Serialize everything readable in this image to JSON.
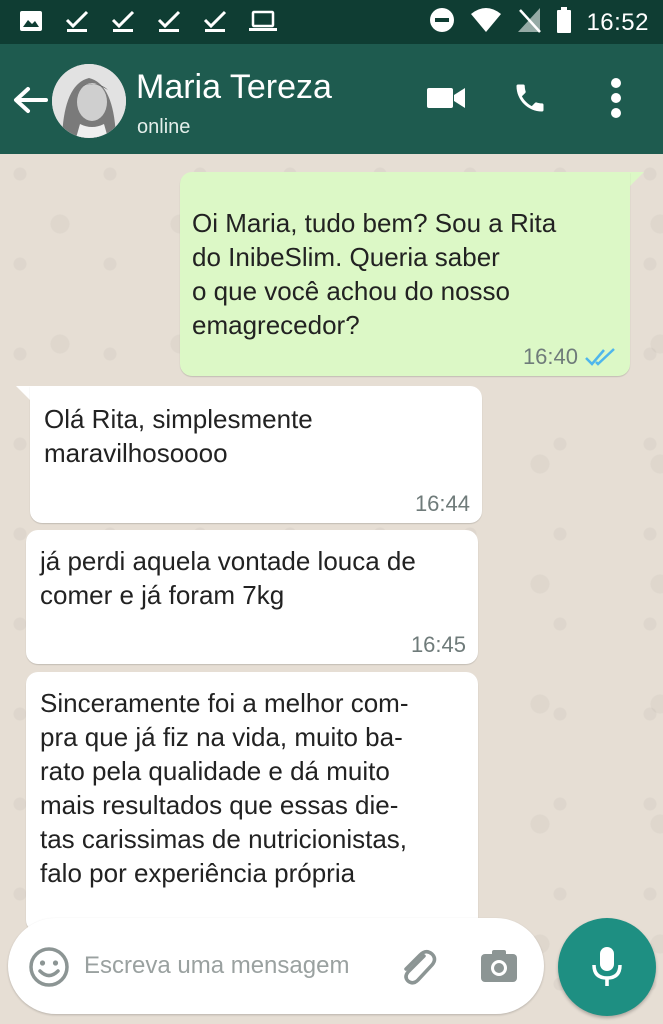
{
  "status_bar": {
    "time": "16:52",
    "left_icons": [
      "image-icon",
      "check-icon",
      "check-icon",
      "check-icon",
      "check-icon",
      "laptop-icon"
    ],
    "right_icons": [
      "do-not-disturb-icon",
      "wifi-icon",
      "no-signal-icon",
      "battery-icon"
    ]
  },
  "header": {
    "contact_name": "Maria Tereza",
    "status": "online",
    "icons": [
      "back-arrow-icon",
      "video-call-icon",
      "phone-icon",
      "more-vert-icon"
    ]
  },
  "messages": [
    {
      "direction": "outgoing",
      "text": "Oi Maria, tudo bem? Sou a Rita\ndo InibeSlim. Queria saber\no que você achou do nosso\nemagrecedor?",
      "time": "16:40",
      "read": true
    },
    {
      "direction": "incoming",
      "text": "Olá Rita, simplesmente\nmaravilhosoooo",
      "time": "16:44"
    },
    {
      "direction": "incoming",
      "text": "já perdi aquela vontade louca de\ncomer e já foram 7kg",
      "time": "16:45"
    },
    {
      "direction": "incoming",
      "text": "Sinceramente foi a melhor com-\npra que já fiz na vida,  muito ba-\nrato pela qualidade e dá muito\nmais resultados que essas die-\ntas carissimas de nutricionistas,\nfalo por experiência própria",
      "time": ""
    }
  ],
  "input": {
    "placeholder": "Escreva uma mensagem",
    "icons": [
      "emoji-icon",
      "attach-icon",
      "camera-icon",
      "mic-icon"
    ]
  },
  "colors": {
    "status_bar": "#0f3d33",
    "header": "#1e5b4f",
    "outgoing_bubble": "#dcf8c6",
    "incoming_bubble": "#ffffff",
    "read_tick": "#4fb6ec",
    "mic_button": "#1e8f82",
    "chat_background": "#e6ded4"
  }
}
